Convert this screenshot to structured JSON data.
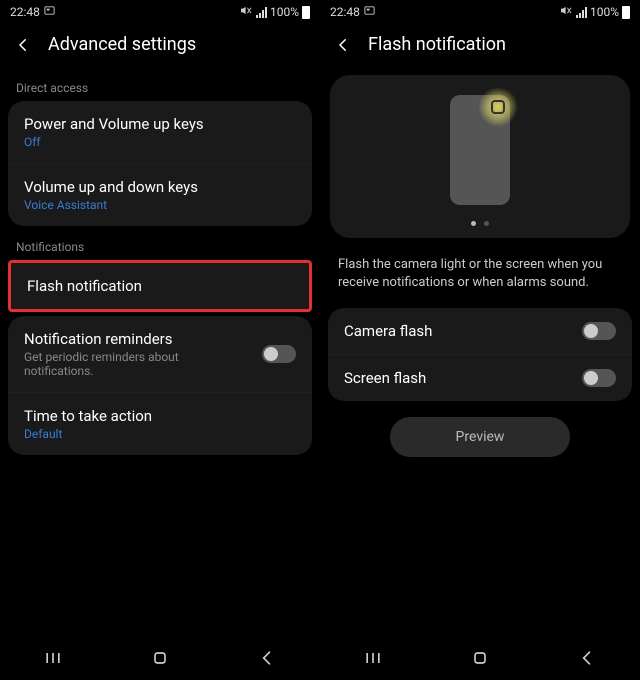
{
  "status": {
    "time": "22:48",
    "battery_pct": "100%"
  },
  "left": {
    "title": "Advanced settings",
    "sections": {
      "direct_access": {
        "label": "Direct access",
        "items": [
          {
            "title": "Power and Volume up keys",
            "sub": "Off"
          },
          {
            "title": "Volume up and down keys",
            "sub": "Voice Assistant"
          }
        ]
      },
      "notifications": {
        "label": "Notifications",
        "items": [
          {
            "title": "Flash notification"
          },
          {
            "title": "Notification reminders",
            "sub": "Get periodic reminders about notifications."
          },
          {
            "title": "Time to take action",
            "sub": "Default"
          }
        ]
      }
    }
  },
  "right": {
    "title": "Flash notification",
    "description": "Flash the camera light or the screen when you receive notifications or when alarms sound.",
    "items": [
      {
        "title": "Camera flash"
      },
      {
        "title": "Screen flash"
      }
    ],
    "preview_btn": "Preview"
  }
}
